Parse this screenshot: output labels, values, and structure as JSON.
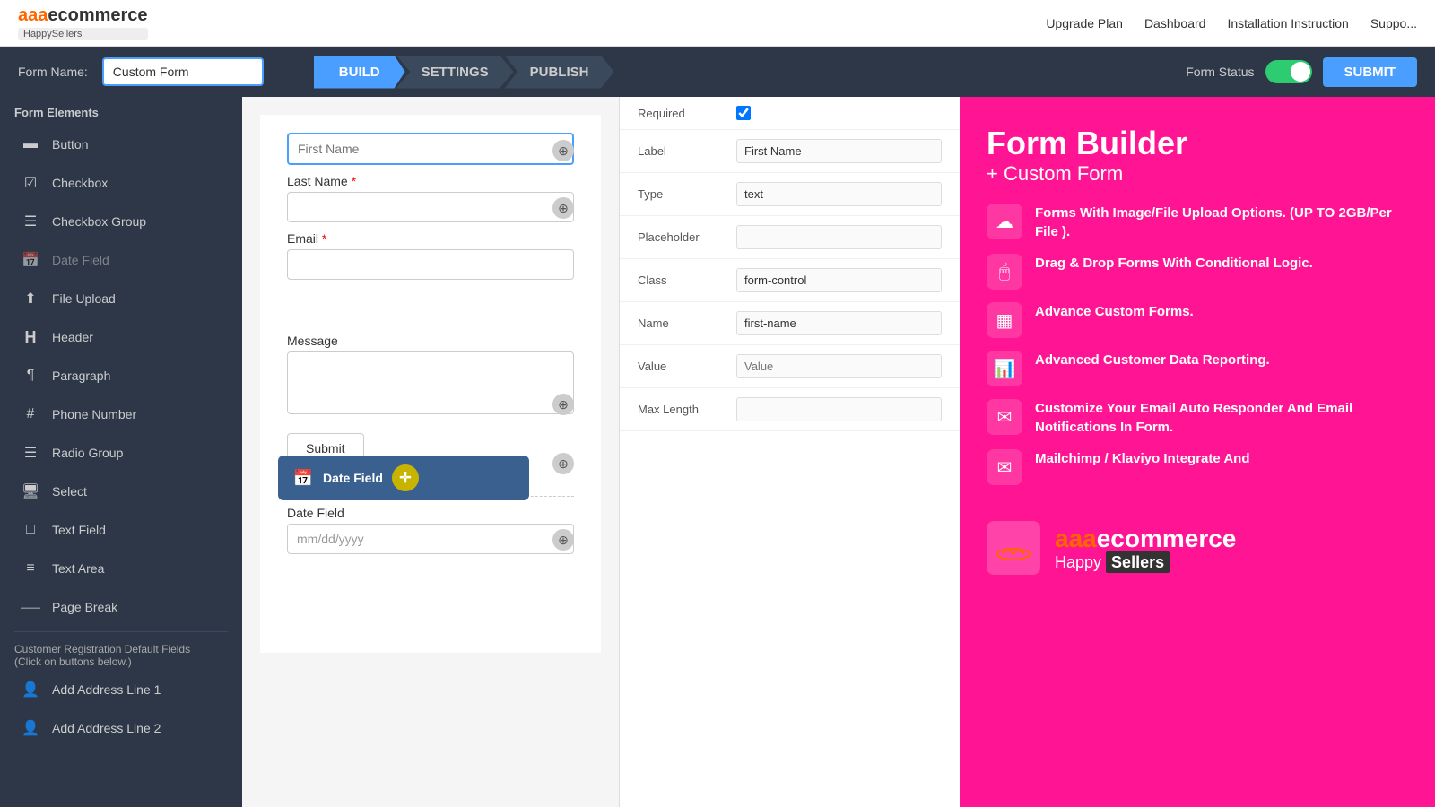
{
  "topnav": {
    "logo_text": "aaaecommerce",
    "logo_sub": "HappySellers",
    "nav_links": [
      "Upgrade Plan",
      "Dashboard",
      "Installation Instruction",
      "Suppo..."
    ]
  },
  "toolbar": {
    "form_name_label": "Form Name:",
    "form_name_value": "Custom Form",
    "tabs": [
      {
        "id": "build",
        "label": "BUILD",
        "active": true
      },
      {
        "id": "settings",
        "label": "SETTINGS",
        "active": false
      },
      {
        "id": "publish",
        "label": "PUBLISH",
        "active": false
      }
    ],
    "form_status_label": "Form Status",
    "submit_label": "SUBMIT"
  },
  "sidebar": {
    "section_title": "Form Elements",
    "items": [
      {
        "id": "button",
        "label": "Button",
        "icon": "▬"
      },
      {
        "id": "checkbox",
        "label": "Checkbox",
        "icon": "☑"
      },
      {
        "id": "checkbox-group",
        "label": "Checkbox Group",
        "icon": "☰"
      },
      {
        "id": "date-field",
        "label": "Date Field",
        "icon": "📅",
        "muted": true
      },
      {
        "id": "file-upload",
        "label": "File Upload",
        "icon": "⬆"
      },
      {
        "id": "header",
        "label": "Header",
        "icon": "H"
      },
      {
        "id": "paragraph",
        "label": "Paragraph",
        "icon": "¶"
      },
      {
        "id": "phone-number",
        "label": "Phone Number",
        "icon": "#"
      },
      {
        "id": "radio-group",
        "label": "Radio Group",
        "icon": "☰"
      },
      {
        "id": "select",
        "label": "Select",
        "icon": "🖥"
      },
      {
        "id": "text-field",
        "label": "Text Field",
        "icon": "□"
      },
      {
        "id": "text-area",
        "label": "Text Area",
        "icon": "≡"
      },
      {
        "id": "page-break",
        "label": "Page Break",
        "icon": "—"
      }
    ],
    "customer_section_title": "Customer Registration Default Fields",
    "customer_section_sub": "(Click on buttons below.)",
    "customer_items": [
      {
        "id": "add-address-1",
        "label": "Add Address Line 1",
        "icon": "👤"
      },
      {
        "id": "add-address-2",
        "label": "Add Address Line 2",
        "icon": "👤"
      }
    ]
  },
  "form_canvas": {
    "fields": [
      {
        "id": "first-name",
        "label": "First Name",
        "required": true,
        "type": "text",
        "highlighted": true
      },
      {
        "id": "last-name",
        "label": "Last Name",
        "required": true,
        "type": "text"
      },
      {
        "id": "email",
        "label": "Email",
        "required": true,
        "type": "text"
      },
      {
        "id": "message",
        "label": "Message",
        "required": false,
        "type": "textarea"
      },
      {
        "id": "date-field",
        "label": "Date Field",
        "required": false,
        "type": "date",
        "placeholder": "mm/dd/yyyy"
      }
    ],
    "submit_label": "Submit",
    "drag_item_label": "Date Field",
    "drag_cursor_icon": "✛"
  },
  "properties": {
    "required_label": "Required",
    "label_label": "Label",
    "label_value": "First Name",
    "type_label": "Type",
    "type_value": "text",
    "placeholder_label": "Placeholder",
    "placeholder_value": "",
    "class_label": "Class",
    "class_value": "form-control",
    "name_label": "Name",
    "name_value": "first-name",
    "value_label": "Value",
    "value_placeholder": "Value",
    "max_length_label": "Max Length",
    "max_length_value": ""
  },
  "promo": {
    "title": "Form Builder",
    "subtitle": "+ Custom Form",
    "features": [
      {
        "icon": "☁",
        "text": "Forms With Image/File Upload Options. (UP TO 2GB/Per File )."
      },
      {
        "icon": "🖱",
        "text": "Drag & Drop Forms With Conditional Logic."
      },
      {
        "icon": "▦",
        "text": "Advance Custom Forms."
      },
      {
        "icon": "📊",
        "text": "Advanced Customer Data Reporting."
      },
      {
        "icon": "✉",
        "text": "Customize Your Email Auto Responder And Email Notifications In Form."
      },
      {
        "icon": "✉",
        "text": "Mailchimp / Klaviyo Integrate And"
      }
    ],
    "logo_text": "aaaecommerce",
    "logo_sub_text": "Happy",
    "sellers_text": "Sellers"
  }
}
